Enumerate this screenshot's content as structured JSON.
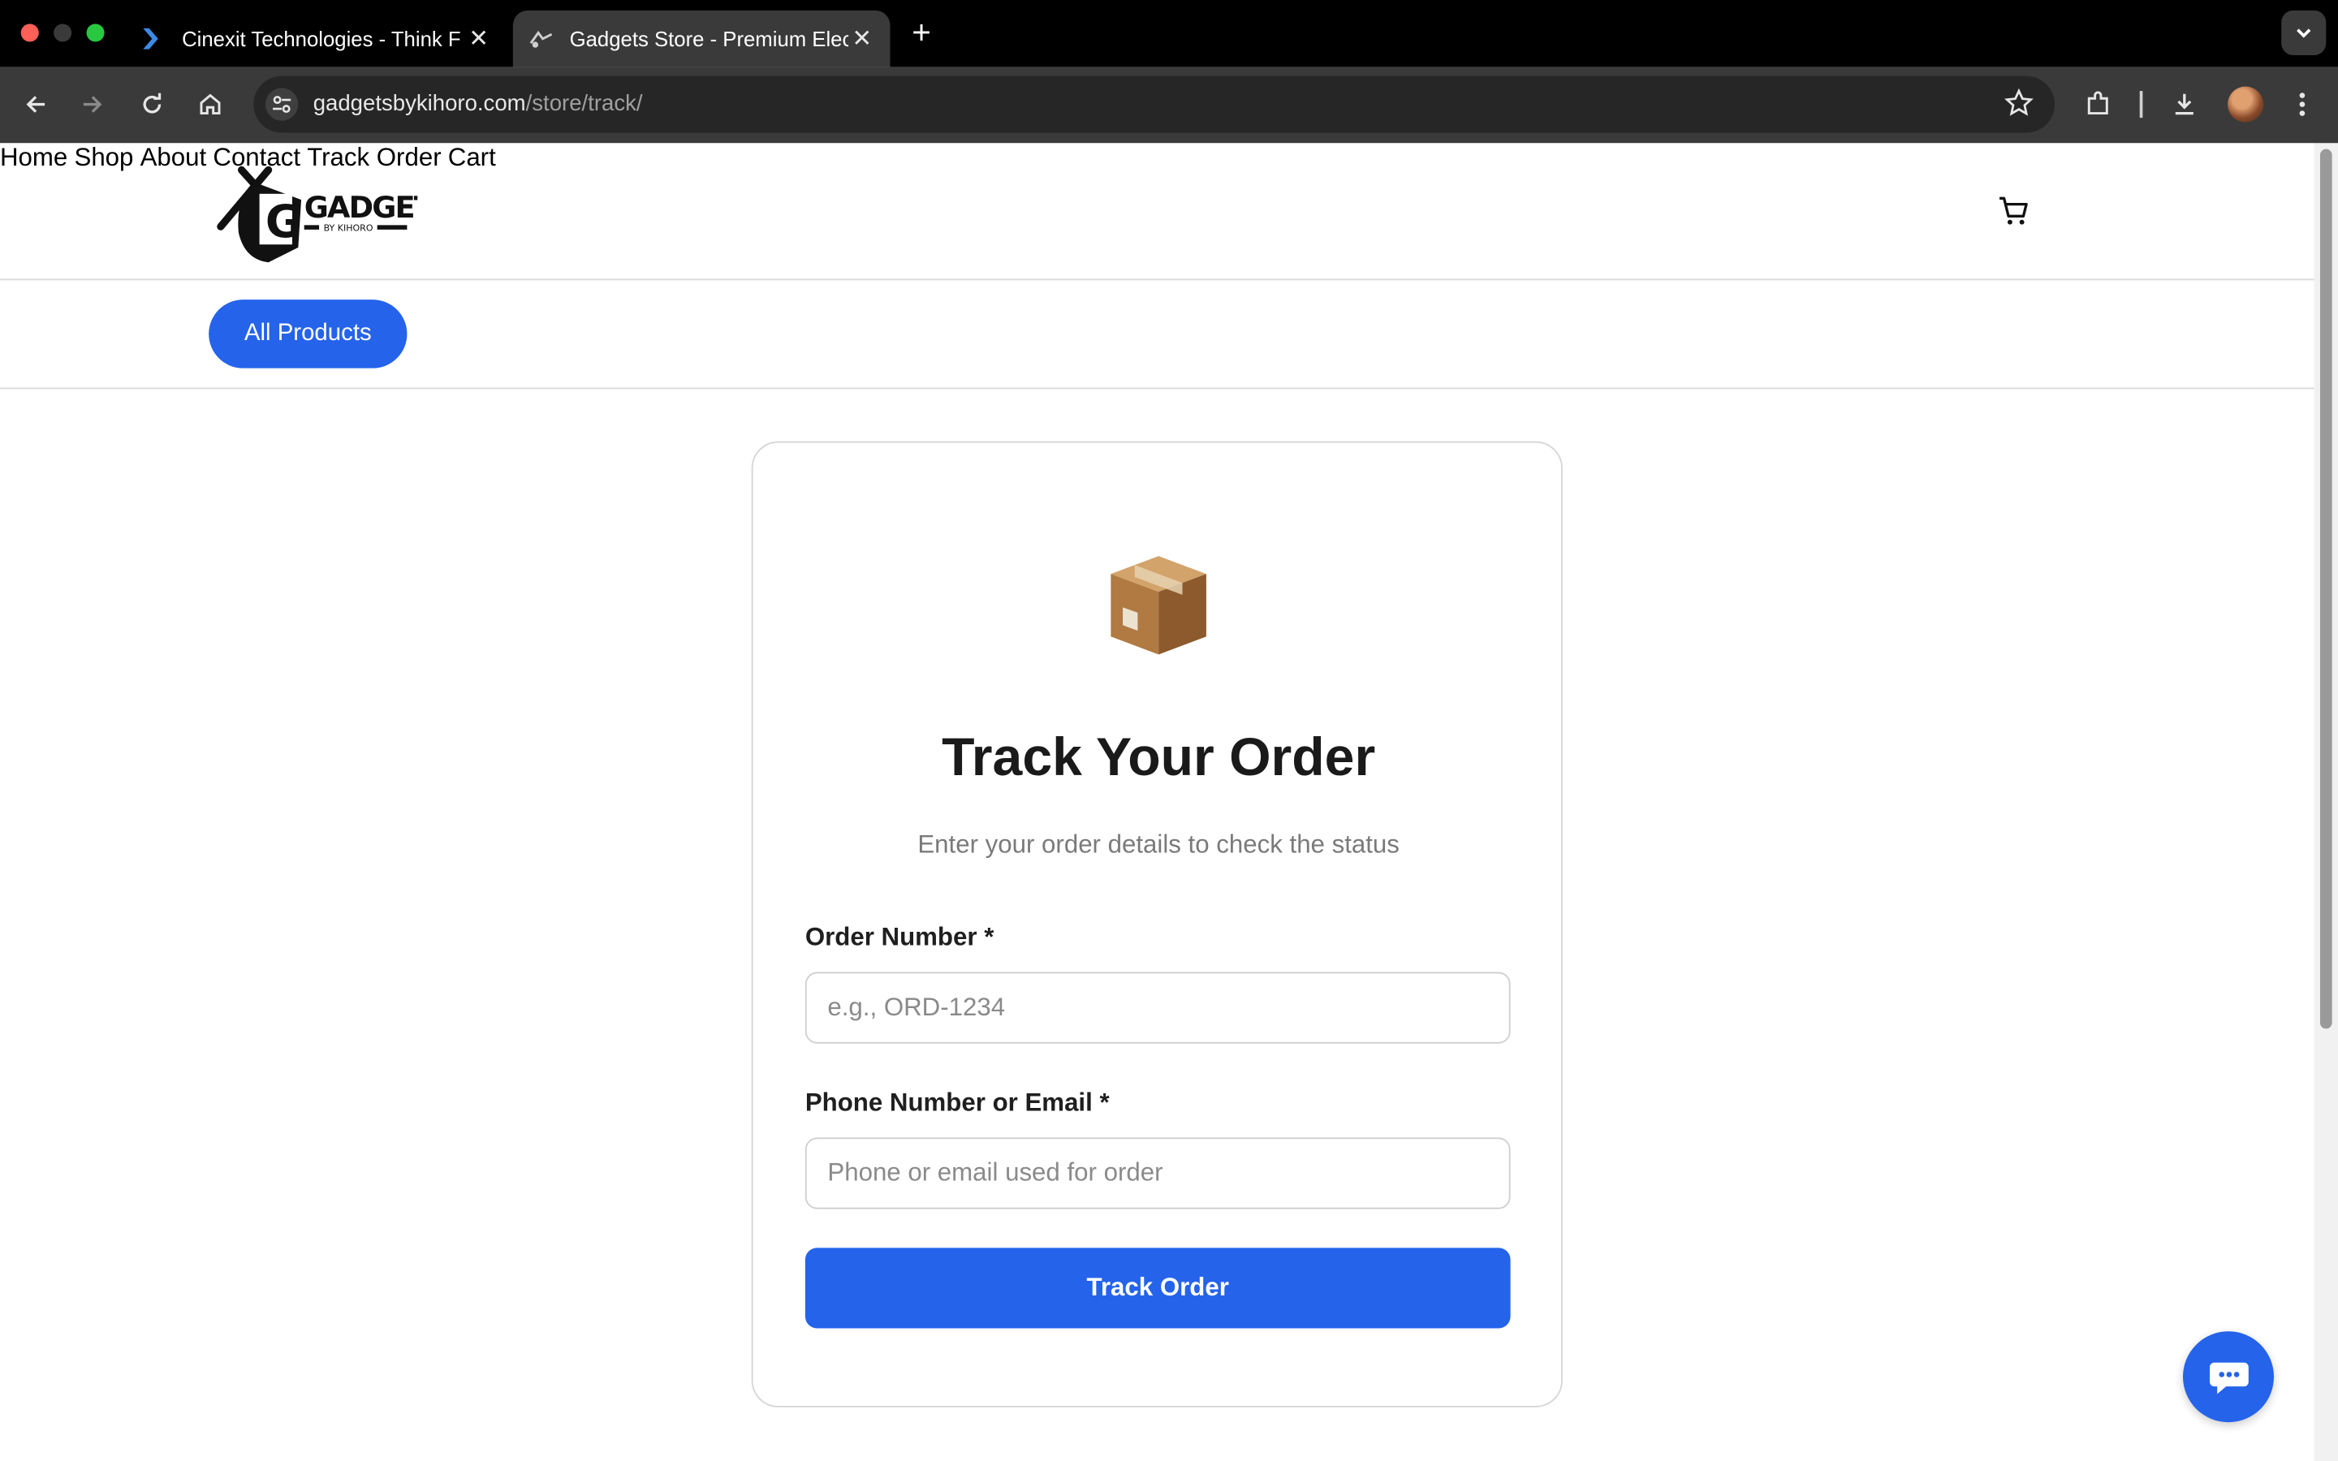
{
  "browser": {
    "tabs": [
      {
        "title": "Cinexit Technologies - Think F",
        "icon": "cinexit-favicon"
      },
      {
        "title": "Gadgets Store - Premium Elec",
        "icon": "gadgets-favicon",
        "active": true
      }
    ],
    "new_tab_label": "+",
    "url_domain": "gadgetsbykihoro.com",
    "url_path": "/store/track/"
  },
  "site": {
    "logo_text": "GADGETS",
    "logo_subtext": "BY KIHORO",
    "nav": {
      "home": "Home",
      "shop": "Shop",
      "about": "About",
      "contact": "Contact",
      "track_order": "Track Order",
      "cart": "Cart"
    },
    "all_products": "All Products"
  },
  "track_form": {
    "icon": "package-icon",
    "title": "Track Your Order",
    "subtitle": "Enter your order details to check the status",
    "order_label": "Order Number *",
    "order_placeholder": "e.g., ORD-1234",
    "order_value": "",
    "contact_label": "Phone Number or Email *",
    "contact_placeholder": "Phone or email used for order",
    "contact_value": "",
    "submit": "Track Order"
  },
  "colors": {
    "accent": "#2563eb",
    "chrome_dark": "#000000",
    "toolbar": "#3a3a3a"
  }
}
